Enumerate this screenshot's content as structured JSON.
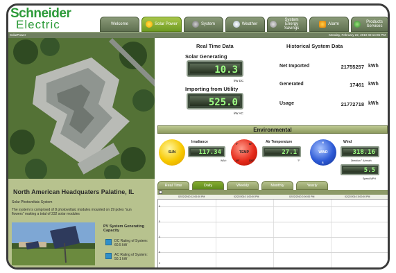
{
  "brand": {
    "line1": "Schneider",
    "line2": "Electric"
  },
  "nav": {
    "tabs": [
      {
        "label": "Welcome",
        "icon": "none"
      },
      {
        "label": "Solar Power",
        "icon": "sun-icon",
        "active": true
      },
      {
        "label": "System",
        "icon": "gear-icon"
      },
      {
        "label": "Weather",
        "icon": "cloud-icon"
      },
      {
        "label": "System Energy Savings",
        "icon": "plug-icon"
      },
      {
        "label": "Alarm",
        "icon": "warning-icon"
      },
      {
        "label": "Products Services",
        "icon": "globe-icon"
      }
    ]
  },
  "subbar": {
    "left": "SolarPower",
    "right": "Monday, February 22, 2010     02:14:06 PM"
  },
  "realtime": {
    "title": "Real Time Data",
    "solar_label": "Solar Generating",
    "solar_value": "10.3",
    "solar_unit": "kW DC",
    "utility_label": "Importing from Utility",
    "utility_value": "525.0",
    "utility_unit": "kW AC"
  },
  "historical": {
    "title": "Historical System Data",
    "rows": [
      {
        "label": "Net Imported",
        "value": "21755257",
        "unit": "kWh"
      },
      {
        "label": "Generated",
        "value": "17461",
        "unit": "kWh"
      },
      {
        "label": "Usage",
        "value": "21772718",
        "unit": "kWh"
      }
    ]
  },
  "environmental": {
    "title": "Environmental",
    "sun_label": "SUN",
    "irradiance_label": "Irradiance",
    "irradiance_value": "117.34",
    "irradiance_unit": "W/M²",
    "temp_ball_label": "TEMP",
    "temp_ball_ticks": [
      "0°",
      "60°",
      "40°",
      "120°"
    ],
    "air_temp_label": "Air Temperature",
    "air_temp_value": "27.1",
    "air_temp_unit": "°F",
    "wind_ball_label": "WIND",
    "wind_ball_dirs": [
      "N",
      "S"
    ],
    "wind_label": "Wind",
    "wind_dir_value": "318.16",
    "wind_dir_unit": "Direction ° Azimuth",
    "wind_speed_value": "5.5",
    "wind_speed_unit": "Speed MPH"
  },
  "period_tabs": [
    {
      "label": "Real Time"
    },
    {
      "label": "Daily",
      "active": true
    },
    {
      "label": "Weekly"
    },
    {
      "label": "Monthly"
    },
    {
      "label": "Yearly"
    }
  ],
  "chart_axis": {
    "ticks": [
      "02/22/2010 12:00:00 PM",
      "02/22/2010 1:00:00 PM",
      "02/22/2010 2:00:00 PM",
      "02/22/2010 3:00:00 PM"
    ],
    "y_labels": [
      "6",
      "5",
      "4",
      "3",
      "2"
    ]
  },
  "site": {
    "title": "North American Headquaters Palatine, IL",
    "subtitle": "Solar Photovoltaic System",
    "description": "The system is comprised of 8 photovoltaic modules mounted on 29 poles \"sun flowers\" making a total of 232 solar modules",
    "capacity_title": "PV System Generating Capacity",
    "dc_rating": "DC Rating of System: 60.5 kW",
    "ac_rating": "AC Rating of System: 50.1 kW"
  },
  "colors": {
    "brand_green": "#2d9b3a",
    "nav_active": "#8bb63a",
    "lcd_text": "#9eff84",
    "env_bar": "#a9b57a"
  }
}
